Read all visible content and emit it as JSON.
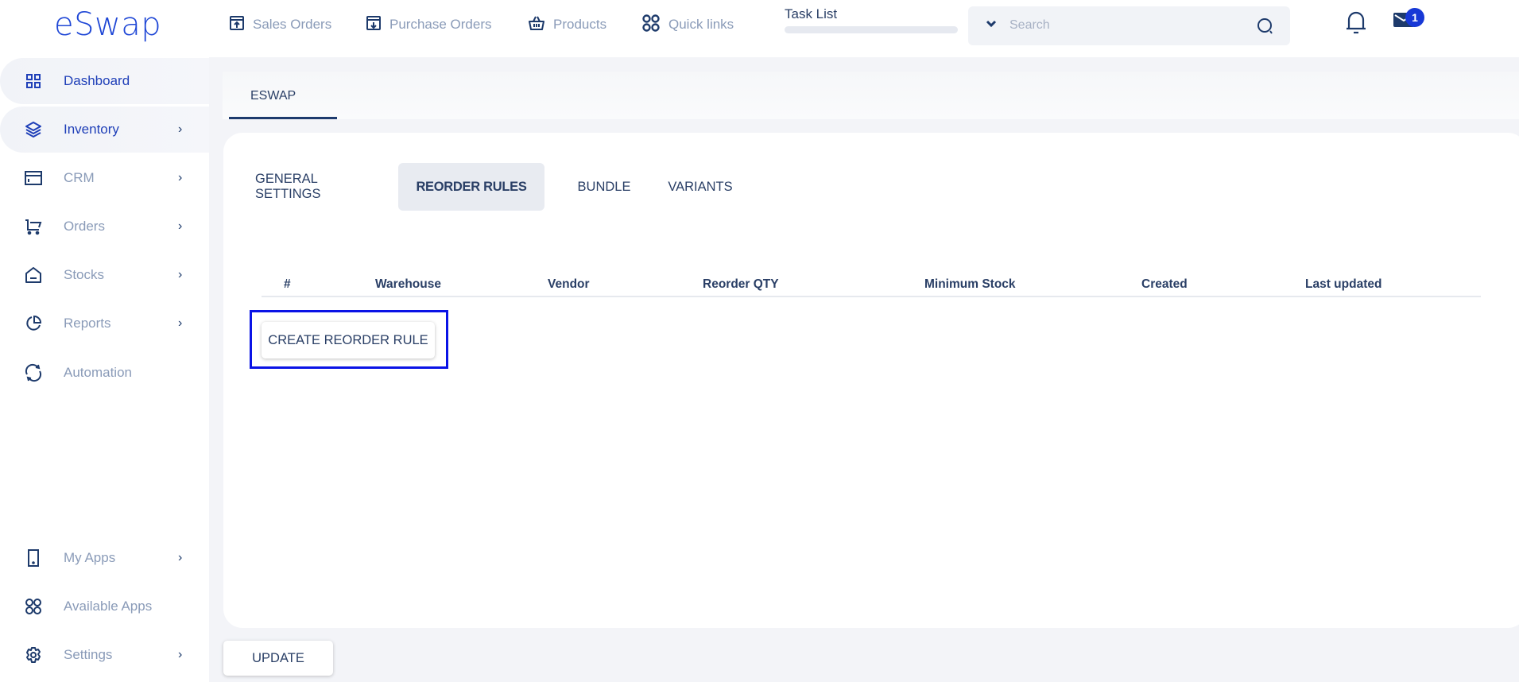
{
  "app": {
    "logo": "eSwap"
  },
  "sidebar": {
    "items": [
      {
        "label": "Dashboard",
        "icon": "dashboard-grid-icon",
        "has_chevron": false,
        "active": true
      },
      {
        "label": "Inventory",
        "icon": "layers-icon",
        "has_chevron": true,
        "active": true
      },
      {
        "label": "CRM",
        "icon": "browser-window-icon",
        "has_chevron": true
      },
      {
        "label": "Orders",
        "icon": "cart-icon",
        "has_chevron": true
      },
      {
        "label": "Stocks",
        "icon": "warehouse-icon",
        "has_chevron": true
      },
      {
        "label": "Reports",
        "icon": "pie-chart-icon",
        "has_chevron": true
      },
      {
        "label": "Automation",
        "icon": "sync-icon",
        "has_chevron": false
      },
      {
        "label": "My Apps",
        "icon": "tablet-icon",
        "has_chevron": true
      },
      {
        "label": "Available Apps",
        "icon": "apps-icon",
        "has_chevron": false
      },
      {
        "label": "Settings",
        "icon": "gear-icon",
        "has_chevron": true
      }
    ],
    "chevron": "›"
  },
  "header": {
    "links": [
      {
        "label": "Sales Orders",
        "icon": "box-upload-icon"
      },
      {
        "label": "Purchase Orders",
        "icon": "box-download-icon"
      },
      {
        "label": "Products",
        "icon": "basket-icon"
      },
      {
        "label": "Quick links",
        "icon": "quick-links-icon"
      }
    ],
    "task_list": {
      "label": "Task List",
      "progress": 0
    },
    "search": {
      "placeholder": "Search",
      "value": ""
    },
    "notifications": {
      "mail_count": "1"
    }
  },
  "page": {
    "top_tab": "ESWAP",
    "tabs": [
      {
        "label": "GENERAL SETTINGS",
        "active": false
      },
      {
        "label": "REORDER RULES",
        "active": true
      },
      {
        "label": "BUNDLE",
        "active": false
      },
      {
        "label": "VARIANTS",
        "active": false
      }
    ],
    "table": {
      "columns": [
        "#",
        "Warehouse",
        "Vendor",
        "Reorder QTY",
        "Minimum Stock",
        "Created",
        "Last updated"
      ],
      "rows": []
    },
    "create_button": "CREATE REORDER RULE",
    "update_button": "UPDATE"
  },
  "colors": {
    "brand": "#1f47d6",
    "text_dark": "#2a3f66",
    "text_muted": "#8a9bb8",
    "focus_outline": "#0a13e6",
    "badge": "#1738d6",
    "online": "#17c35b"
  }
}
